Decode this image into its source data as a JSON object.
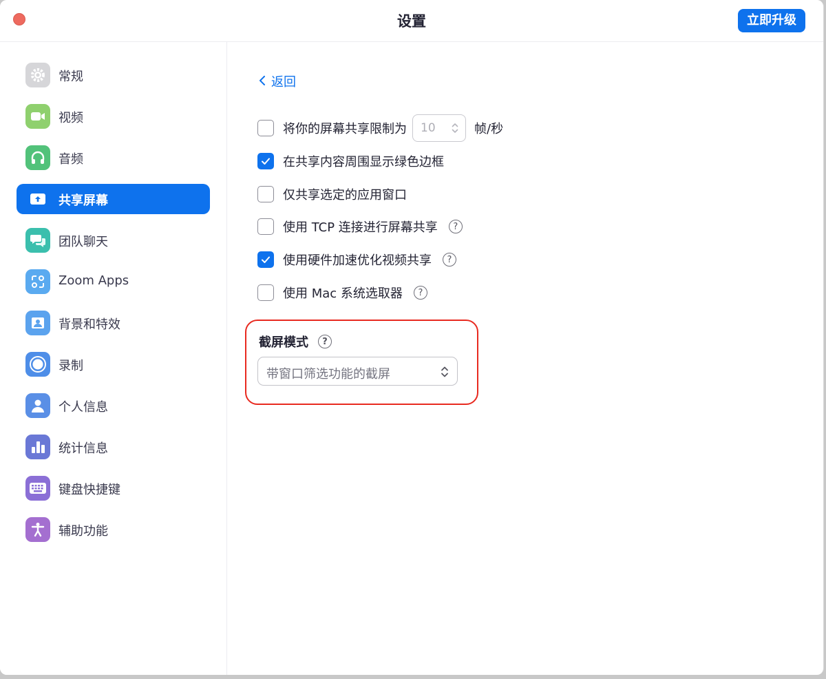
{
  "window": {
    "title": "设置",
    "upgrade_label": "立即升级"
  },
  "sidebar": {
    "items": [
      {
        "label": "常规",
        "icon": "gear-icon",
        "color": "#d6d6d9"
      },
      {
        "label": "视频",
        "icon": "video-camera-icon",
        "color": "#8fd06e"
      },
      {
        "label": "音频",
        "icon": "headphones-icon",
        "color": "#52c27a"
      },
      {
        "label": "共享屏幕",
        "icon": "share-screen-icon",
        "color": "#0e72ed",
        "active": true
      },
      {
        "label": "团队聊天",
        "icon": "chat-icon",
        "color": "#3bbfad"
      },
      {
        "label": "Zoom Apps",
        "icon": "apps-icon",
        "color": "#5aaaf0"
      },
      {
        "label": "背景和特效",
        "icon": "background-icon",
        "color": "#5ba3ee"
      },
      {
        "label": "录制",
        "icon": "record-icon",
        "color": "#4e8ee8"
      },
      {
        "label": "个人信息",
        "icon": "profile-icon",
        "color": "#5a8fe6"
      },
      {
        "label": "统计信息",
        "icon": "statistics-icon",
        "color": "#6a78d6"
      },
      {
        "label": "键盘快捷键",
        "icon": "keyboard-icon",
        "color": "#8b6fd6"
      },
      {
        "label": "辅助功能",
        "icon": "accessibility-icon",
        "color": "#a46fd0"
      }
    ]
  },
  "content": {
    "back_label": "返回",
    "options": [
      {
        "label": "将你的屏幕共享限制为",
        "checked": false,
        "stepper_value": "10",
        "unit": "帧/秒"
      },
      {
        "label": "在共享内容周围显示绿色边框",
        "checked": true
      },
      {
        "label": "仅共享选定的应用窗口",
        "checked": false
      },
      {
        "label": "使用 TCP 连接进行屏幕共享",
        "checked": false,
        "help": "?"
      },
      {
        "label": "使用硬件加速优化视频共享",
        "checked": true,
        "help": "?"
      },
      {
        "label": "使用 Mac 系统选取器",
        "checked": false,
        "help": "?"
      }
    ],
    "screenshot_mode": {
      "title": "截屏模式",
      "help": "?",
      "selected": "带窗口筛选功能的截屏"
    }
  },
  "colors": {
    "accent": "#0e72ed",
    "highlight_border": "#e8291f"
  }
}
